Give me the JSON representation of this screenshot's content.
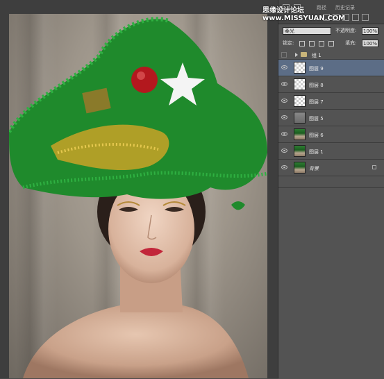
{
  "watermark": "思缘设计论坛 www.MISSYUAN.COM",
  "top_tabs": [
    "路径",
    "历史记录"
  ],
  "blend_mode": "柔光",
  "opacity_label": "不透明度:",
  "opacity_value": "100%",
  "lock_label": "锁定:",
  "fill_label": "填充:",
  "fill_value": "100%",
  "layers": [
    {
      "name": "组 1",
      "type": "group",
      "visible": false
    },
    {
      "name": "图层 9",
      "type": "layer",
      "thumb": "trans",
      "visible": true,
      "selected": true
    },
    {
      "name": "图层 8",
      "type": "layer",
      "thumb": "trans",
      "visible": true
    },
    {
      "name": "图层 7",
      "type": "layer",
      "thumb": "trans",
      "visible": true
    },
    {
      "name": "图层 5",
      "type": "layer",
      "thumb": "grey",
      "visible": true
    },
    {
      "name": "图层 6",
      "type": "layer",
      "thumb": "pic",
      "visible": true
    },
    {
      "name": "图层 1",
      "type": "layer",
      "thumb": "pic",
      "visible": true
    },
    {
      "name": "背景",
      "type": "background",
      "thumb": "pic",
      "visible": true,
      "locked": true
    }
  ],
  "colors": {
    "panel_bg": "#535353",
    "selected_layer": "#5c6d86",
    "canvas_bg": "#3e3e3e",
    "tinsel_green": "#1f8a2c",
    "tinsel_gold": "#c9a227",
    "lip_red": "#c2263a"
  }
}
